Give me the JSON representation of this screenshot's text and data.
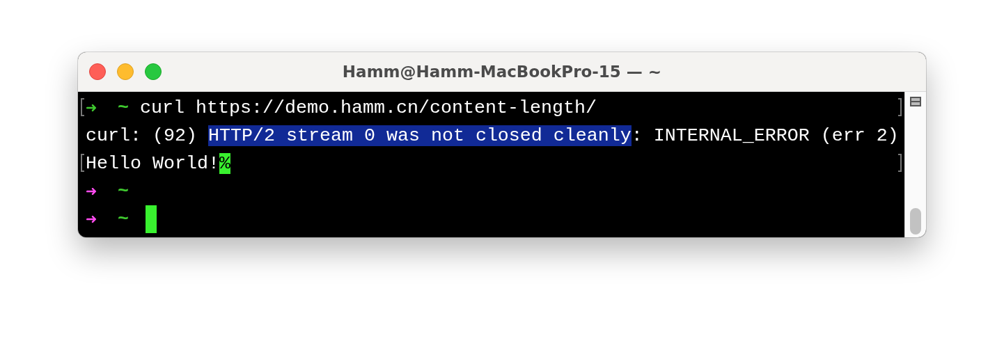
{
  "window": {
    "title": "Hamm@Hamm-MacBookPro-15 — ~"
  },
  "lines": [
    {
      "kind": "prompt",
      "arrow": "➜",
      "color": "#3fc92f",
      "dir": "~",
      "command": "curl https://demo.hamm.cn/content-length/",
      "marked": true,
      "cursor": false
    },
    {
      "kind": "output",
      "marked": false,
      "segments": [
        {
          "text": "curl: (92) ",
          "selected": false
        },
        {
          "text": "HTTP/2 stream 0 was not closed cleanly",
          "selected": true
        },
        {
          "text": ": INTERNAL_ERROR (err 2)",
          "selected": false
        }
      ]
    },
    {
      "kind": "output",
      "marked": true,
      "segments": [
        {
          "text": "Hello World!",
          "selected": false
        }
      ],
      "end_mark": "%"
    },
    {
      "kind": "prompt",
      "arrow": "➜",
      "color": "#ff4cf0",
      "dir": "~",
      "marked": false,
      "cursor": false
    },
    {
      "kind": "prompt",
      "arrow": "➜",
      "color": "#ff4cf0",
      "dir": "~",
      "marked": false,
      "cursor": true
    }
  ]
}
